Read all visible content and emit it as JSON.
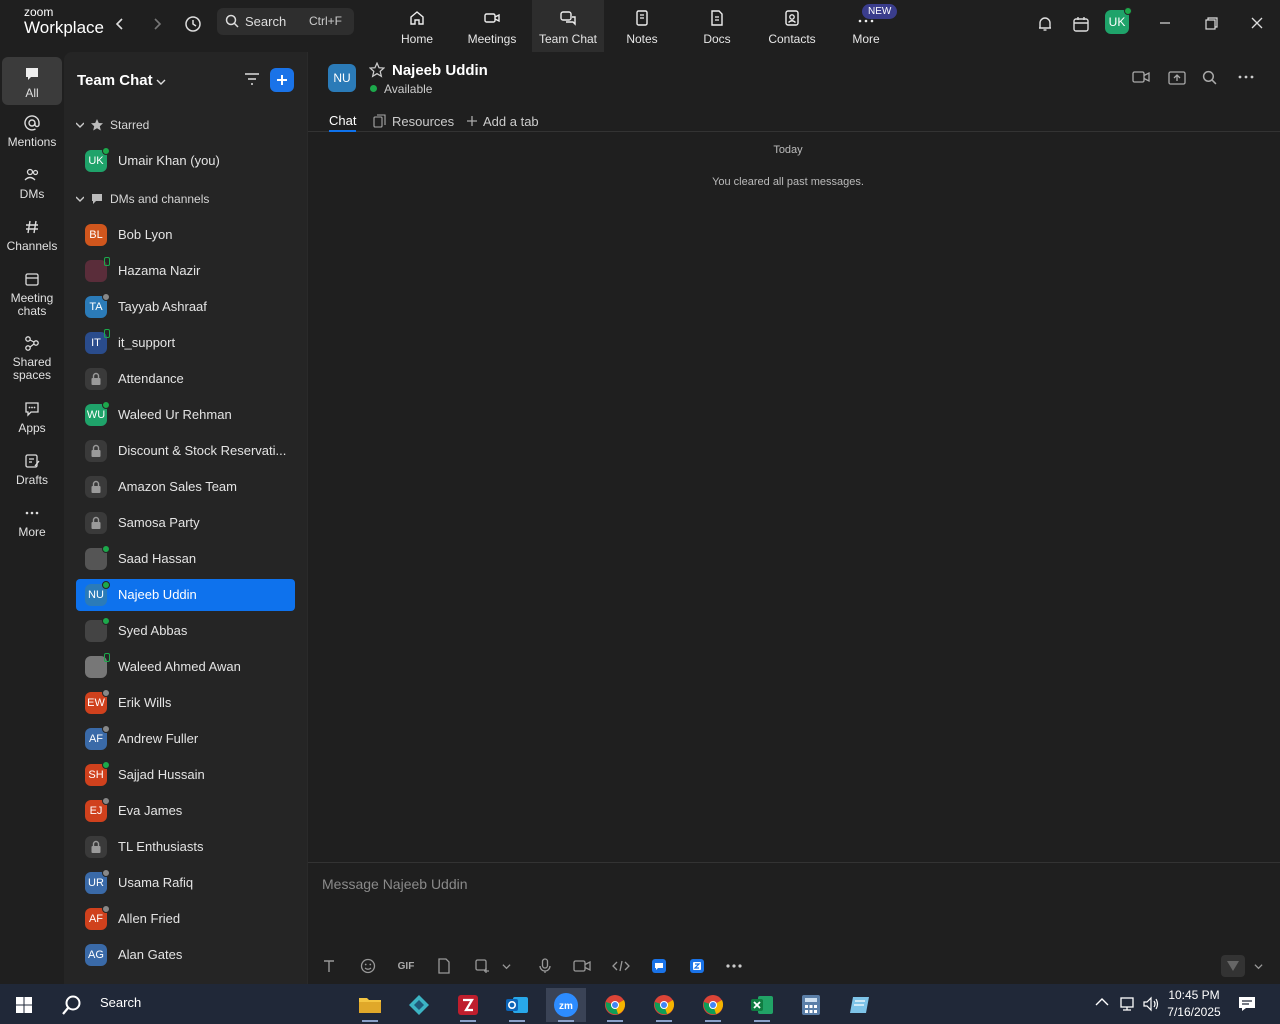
{
  "app": {
    "logo_top": "zoom",
    "logo_bottom": "Workplace"
  },
  "search": {
    "label": "Search",
    "shortcut": "Ctrl+F"
  },
  "nav": [
    {
      "label": "Home",
      "icon": "home-icon"
    },
    {
      "label": "Meetings",
      "icon": "video-camera-icon"
    },
    {
      "label": "Team Chat",
      "icon": "chat-bubbles-icon",
      "active": true
    },
    {
      "label": "Notes",
      "icon": "notes-icon"
    },
    {
      "label": "Docs",
      "icon": "docs-icon"
    },
    {
      "label": "Contacts",
      "icon": "contacts-icon"
    },
    {
      "label": "More",
      "icon": "more-icon"
    }
  ],
  "new_badge": "NEW",
  "user_avatar": "UK",
  "rail": [
    {
      "label": "All",
      "icon": "chat-icon",
      "active": true
    },
    {
      "label": "Mentions",
      "icon": "at-icon"
    },
    {
      "label": "DMs",
      "icon": "people-icon"
    },
    {
      "label": "Channels",
      "icon": "hash-icon"
    },
    {
      "label": "Meeting chats",
      "icon": "calendar-icon"
    },
    {
      "label": "Shared spaces",
      "icon": "shared-spaces-icon"
    },
    {
      "label": "Apps",
      "icon": "apps-icon"
    },
    {
      "label": "Drafts",
      "icon": "drafts-icon"
    },
    {
      "label": "More",
      "icon": "ellipsis-icon"
    }
  ],
  "sidebar": {
    "title": "Team Chat",
    "starred_label": "Starred",
    "dms_label": "DMs and channels",
    "starred": [
      {
        "name": "Umair Khan (you)",
        "initials": "UK",
        "color": "#1fa36a",
        "status": "online"
      }
    ],
    "items": [
      {
        "name": "Bob Lyon",
        "initials": "BL",
        "color": "#d0561d",
        "status": "none"
      },
      {
        "name": "Hazama Nazir",
        "initials": "",
        "color": "#5a2d3a",
        "status": "mobile"
      },
      {
        "name": "Tayyab Ashraaf",
        "initials": "TA",
        "color": "#2b7bb8",
        "status": "offline"
      },
      {
        "name": "it_support",
        "initials": "IT",
        "color": "#2a4c8c",
        "status": "mobile"
      },
      {
        "name": "Attendance",
        "initials": "",
        "color": "#3a3a3a",
        "status": "lock"
      },
      {
        "name": "Waleed Ur Rehman",
        "initials": "WU",
        "color": "#1fa36a",
        "status": "online"
      },
      {
        "name": "Discount & Stock Reservati...",
        "initials": "",
        "color": "#3a3a3a",
        "status": "lock"
      },
      {
        "name": "Amazon Sales Team",
        "initials": "",
        "color": "#3a3a3a",
        "status": "lock"
      },
      {
        "name": "Samosa Party",
        "initials": "",
        "color": "#3a3a3a",
        "status": "lock"
      },
      {
        "name": "Saad Hassan",
        "initials": "",
        "color": "#555555",
        "status": "online"
      },
      {
        "name": "Najeeb Uddin",
        "initials": "NU",
        "color": "#2b7bb8",
        "status": "online",
        "selected": true
      },
      {
        "name": "Syed Abbas",
        "initials": "",
        "color": "#444444",
        "status": "online"
      },
      {
        "name": "Waleed Ahmed Awan",
        "initials": "",
        "color": "#777777",
        "status": "mobile"
      },
      {
        "name": "Erik Wills",
        "initials": "EW",
        "color": "#d0411d",
        "status": "offline"
      },
      {
        "name": "Andrew Fuller",
        "initials": "AF",
        "color": "#3a6aa8",
        "status": "offline"
      },
      {
        "name": "Sajjad Hussain",
        "initials": "SH",
        "color": "#d0411d",
        "status": "online"
      },
      {
        "name": "Eva James",
        "initials": "EJ",
        "color": "#d0411d",
        "status": "offline"
      },
      {
        "name": "TL Enthusiasts",
        "initials": "",
        "color": "#3a3a3a",
        "status": "lock"
      },
      {
        "name": "Usama Rafiq",
        "initials": "UR",
        "color": "#3a6aa8",
        "status": "offline"
      },
      {
        "name": "Allen Fried",
        "initials": "AF",
        "color": "#d0411d",
        "status": "away"
      },
      {
        "name": "Alan Gates",
        "initials": "AG",
        "color": "#3a6aa8",
        "status": "none"
      }
    ]
  },
  "chat": {
    "contact_initials": "NU",
    "contact_name": "Najeeb Uddin",
    "status": "Available",
    "tabs": [
      "Chat",
      "Resources",
      "Add a tab"
    ],
    "day_label": "Today",
    "system_message": "You cleared all past messages.",
    "composer_placeholder": "Message Najeeb Uddin",
    "gif_label": "GIF"
  },
  "taskbar": {
    "search_label": "Search",
    "time": "10:45 PM",
    "date": "7/16/2025"
  }
}
